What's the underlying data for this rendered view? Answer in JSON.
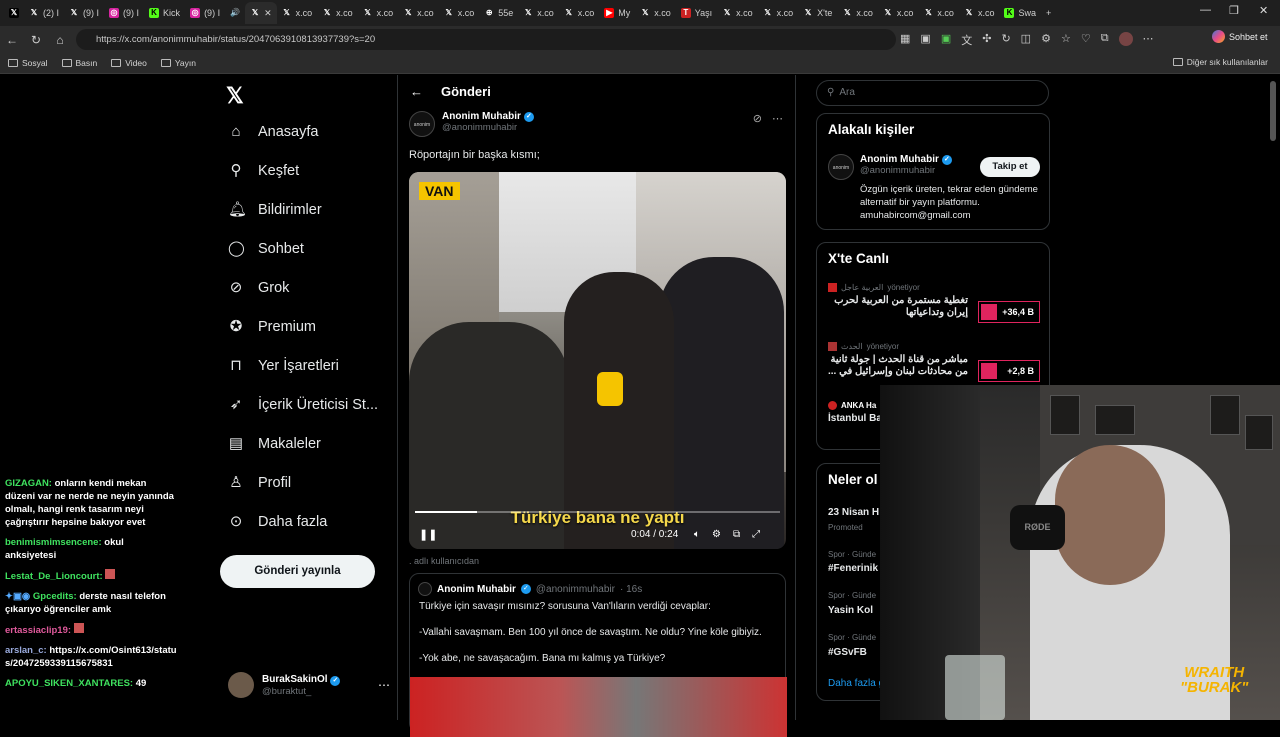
{
  "browser": {
    "tabs": [
      {
        "label": "",
        "icon": "X"
      },
      {
        "label": "(2) I",
        "icon": "X"
      },
      {
        "label": "(9) I",
        "icon": "X"
      },
      {
        "label": "(9) I",
        "icon": "instagram"
      },
      {
        "label": "Kick",
        "icon": "kick"
      },
      {
        "label": "(9) I",
        "icon": "instagram"
      },
      {
        "label": "",
        "icon": "audio"
      },
      {
        "label": "x.co",
        "icon": "X"
      },
      {
        "label": "x.co",
        "icon": "X"
      },
      {
        "label": "x.co",
        "icon": "X"
      },
      {
        "label": "x.co",
        "icon": "X"
      },
      {
        "label": "x.co",
        "icon": "X"
      },
      {
        "label": "x.co",
        "icon": "X"
      },
      {
        "label": "55e",
        "icon": "globe"
      },
      {
        "label": "x.co",
        "icon": "X"
      },
      {
        "label": "x.co",
        "icon": "X"
      },
      {
        "label": "My",
        "icon": "youtube"
      },
      {
        "label": "x.co",
        "icon": "X"
      },
      {
        "label": "Yaşı",
        "icon": "red"
      },
      {
        "label": "x.co",
        "icon": "X"
      },
      {
        "label": "x.co",
        "icon": "X"
      },
      {
        "label": "X'te",
        "icon": "X"
      },
      {
        "label": "x.co",
        "icon": "X"
      },
      {
        "label": "x.co",
        "icon": "X"
      },
      {
        "label": "x.co",
        "icon": "X"
      },
      {
        "label": "x.co",
        "icon": "X"
      },
      {
        "label": "Swa",
        "icon": "kick"
      }
    ],
    "url": "https://x.com/anonimmuhabir/status/2047063910813937739?s=20",
    "copilot_label": "Sohbet et",
    "bookmarks": [
      "Sosyal",
      "Basın",
      "Video",
      "Yayın"
    ],
    "bookmarks_other": "Diğer sık kullanılanlar"
  },
  "sidebar": {
    "items": [
      {
        "label": "Anasayfa",
        "icon": "home-icon"
      },
      {
        "label": "Keşfet",
        "icon": "search-icon"
      },
      {
        "label": "Bildirimler",
        "icon": "bell-icon"
      },
      {
        "label": "Sohbet",
        "icon": "chat-icon"
      },
      {
        "label": "Grok",
        "icon": "grok-icon"
      },
      {
        "label": "Premium",
        "icon": "premium-icon"
      },
      {
        "label": "Yer İşaretleri",
        "icon": "bookmark-icon"
      },
      {
        "label": "İçerik Üreticisi St...",
        "icon": "rocket-icon"
      },
      {
        "label": "Makaleler",
        "icon": "article-icon"
      },
      {
        "label": "Profil",
        "icon": "profile-icon"
      },
      {
        "label": "Daha fazla",
        "icon": "more-icon"
      }
    ],
    "post_button": "Gönderi yayınla",
    "account": {
      "name": "BurakSakinOl",
      "handle": "@buraktut_"
    }
  },
  "main": {
    "header": "Gönderi",
    "post": {
      "name": "Anonim Muhabir",
      "handle": "@anonimmuhabir",
      "text": "Röportajın bir başka kısmı;",
      "video": {
        "location_label": "VAN",
        "speed_badge": "1.00",
        "subtitle": "Türkiye bana ne yaptı",
        "time": "0:04 / 0:24",
        "progress": 0.17
      }
    },
    "repost_label": ". adlı kullanıcıdan",
    "quote": {
      "name": "Anonim Muhabir",
      "handle": "@anonimmuhabir",
      "age": "· 16s",
      "lines": [
        "Türkiye için savaşır mısınız? sorusuna Van'lıların verdiği cevaplar:",
        "-Vallahi savaşmam. Ben 100 yıl önce de savaştım. Ne oldu? Yine köle gibiyiz.",
        "-Yok abe, ne savaşacağım. Bana mı kalmış ya Türkiye?"
      ]
    }
  },
  "right": {
    "search_placeholder": "Ara",
    "related": {
      "title": "Alakalı kişiler",
      "name": "Anonim Muhabir",
      "handle": "@anonimmuhabir",
      "follow": "Takip et",
      "bio": "Özgün içerik üreten, tekrar eden gündeme alternatif bir yayın platformu. amuhabircom@gmail.com"
    },
    "live": {
      "title": "X'te Canlı",
      "items": [
        {
          "source": "العربية عاجل",
          "status": "yönetiyor",
          "text": "تغطية مستمرة من العربية لحرب إيران وتداعياتها",
          "count": "+36,4 B"
        },
        {
          "source": "الحدث",
          "status": "yönetiyor",
          "text": "مباشر من قناة الحدث | جولة ثانية من محادثات لبنان وإسرائيل في ...",
          "count": "+2,8 B"
        },
        {
          "source": "ANKA Ha",
          "status": "",
          "text": "İstanbul Ba arasında, \"",
          "count": ""
        }
      ]
    },
    "trends": {
      "title": "Neler ol",
      "items": [
        {
          "meta": "",
          "name": "23 Nisan H",
          "sub": "Promoted"
        },
        {
          "meta": "Spor · Günde",
          "name": "#Fenerinik",
          "sub": ""
        },
        {
          "meta": "Spor · Günde",
          "name": "Yasin Kol",
          "sub": ""
        },
        {
          "meta": "Spor · Günde",
          "name": "#GSvFB",
          "sub": ""
        }
      ],
      "show_more": "Daha fazla göster"
    }
  },
  "chat": [
    {
      "user": "GIZAGAN:",
      "text": "onların kendi mekan düzeni var ne nerde ne neyin yanında olmalı, hangi renk tasarım neyi çağrıştırır hepsine bakıyor evet",
      "color": "#3fe25f"
    },
    {
      "user": "benimismimsencene:",
      "text": "okul anksiyetesi",
      "color": "#3fe25f"
    },
    {
      "user": "Lestat_De_Lioncourt:",
      "text": "",
      "color": "#3fe25f"
    },
    {
      "user": "Gpcedits:",
      "text": "derste nasıl telefon çıkarıyo öğrenciler amk",
      "color": "#3fe25f"
    },
    {
      "user": "ertassiaclip19:",
      "text": "",
      "color": "#e05a9c"
    },
    {
      "user": "arslan_c:",
      "text": "https://x.com/Osint613/status/2047259339115675831",
      "color": "#9ad"
    },
    {
      "user": "APOYU_SIKEN_XANTARES:",
      "text": "49",
      "color": "#3fe25f"
    }
  ],
  "overlay": {
    "logo_line1": "WRAITH",
    "logo_line2": "\"BURAK\"",
    "mic_label": "RØDE"
  }
}
